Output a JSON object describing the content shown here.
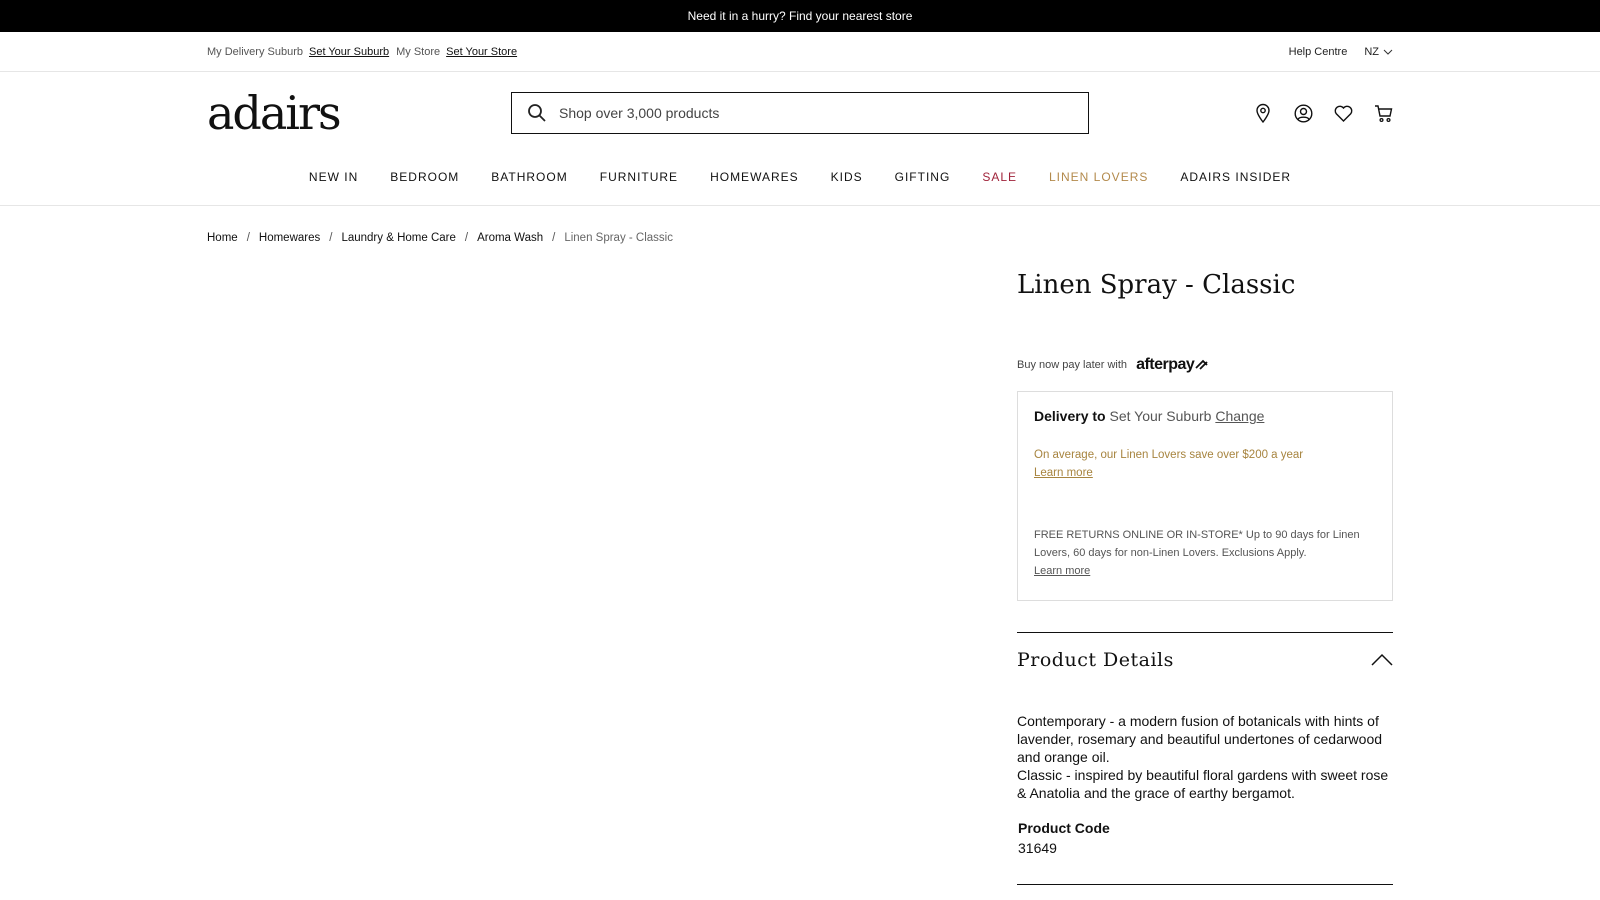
{
  "promo": {
    "text": "Need it in a hurry? Find your nearest store"
  },
  "utility": {
    "delivery_label": "My Delivery Suburb",
    "delivery_link": "Set Your Suburb",
    "store_label": "My Store",
    "store_link": "Set Your Store",
    "help": "Help Centre",
    "country": "NZ"
  },
  "header": {
    "logo": "adairs",
    "search_placeholder": "Shop over 3,000 products",
    "icons": [
      "location-pin-icon",
      "account-icon",
      "wishlist-heart-icon",
      "cart-icon"
    ]
  },
  "nav": {
    "items": [
      "NEW IN",
      "BEDROOM",
      "BATHROOM",
      "FURNITURE",
      "HOMEWARES",
      "KIDS",
      "GIFTING",
      "SALE",
      "LINEN LOVERS",
      "ADAIRS INSIDER"
    ]
  },
  "breadcrumb": {
    "items": [
      "Home",
      "Homewares",
      "Laundry & Home Care",
      "Aroma Wash"
    ],
    "current": "Linen Spray - Classic"
  },
  "product": {
    "title": "Linen Spray - Classic",
    "afterpay_label": "Buy now pay later with",
    "afterpay_brand": "afterpay",
    "delivery": {
      "label": "Delivery to",
      "suburb": "Set Your Suburb",
      "change": "Change"
    },
    "linen_lovers": {
      "text": "On average, our Linen Lovers save over $200 a year",
      "link": "Learn more"
    },
    "returns": {
      "text": "FREE RETURNS ONLINE OR IN-STORE* Up to 90 days for Linen Lovers, 60 days for non-Linen Lovers. Exclusions Apply.",
      "link": "Learn more"
    },
    "details": {
      "heading": "Product Details",
      "desc1": "Contemporary - a modern fusion of botanicals with hints of lavender, rosemary and beautiful undertones of cedarwood and orange oil.",
      "desc2": "Classic - inspired by beautiful floral gardens with sweet rose & Anatolia and the grace of earthy bergamot.",
      "code_label": "Product Code",
      "code": "31649"
    }
  },
  "colors": {
    "sale": "#a0233a",
    "linen_lovers": "#b38a4c",
    "ll_save": "#a7843f"
  }
}
